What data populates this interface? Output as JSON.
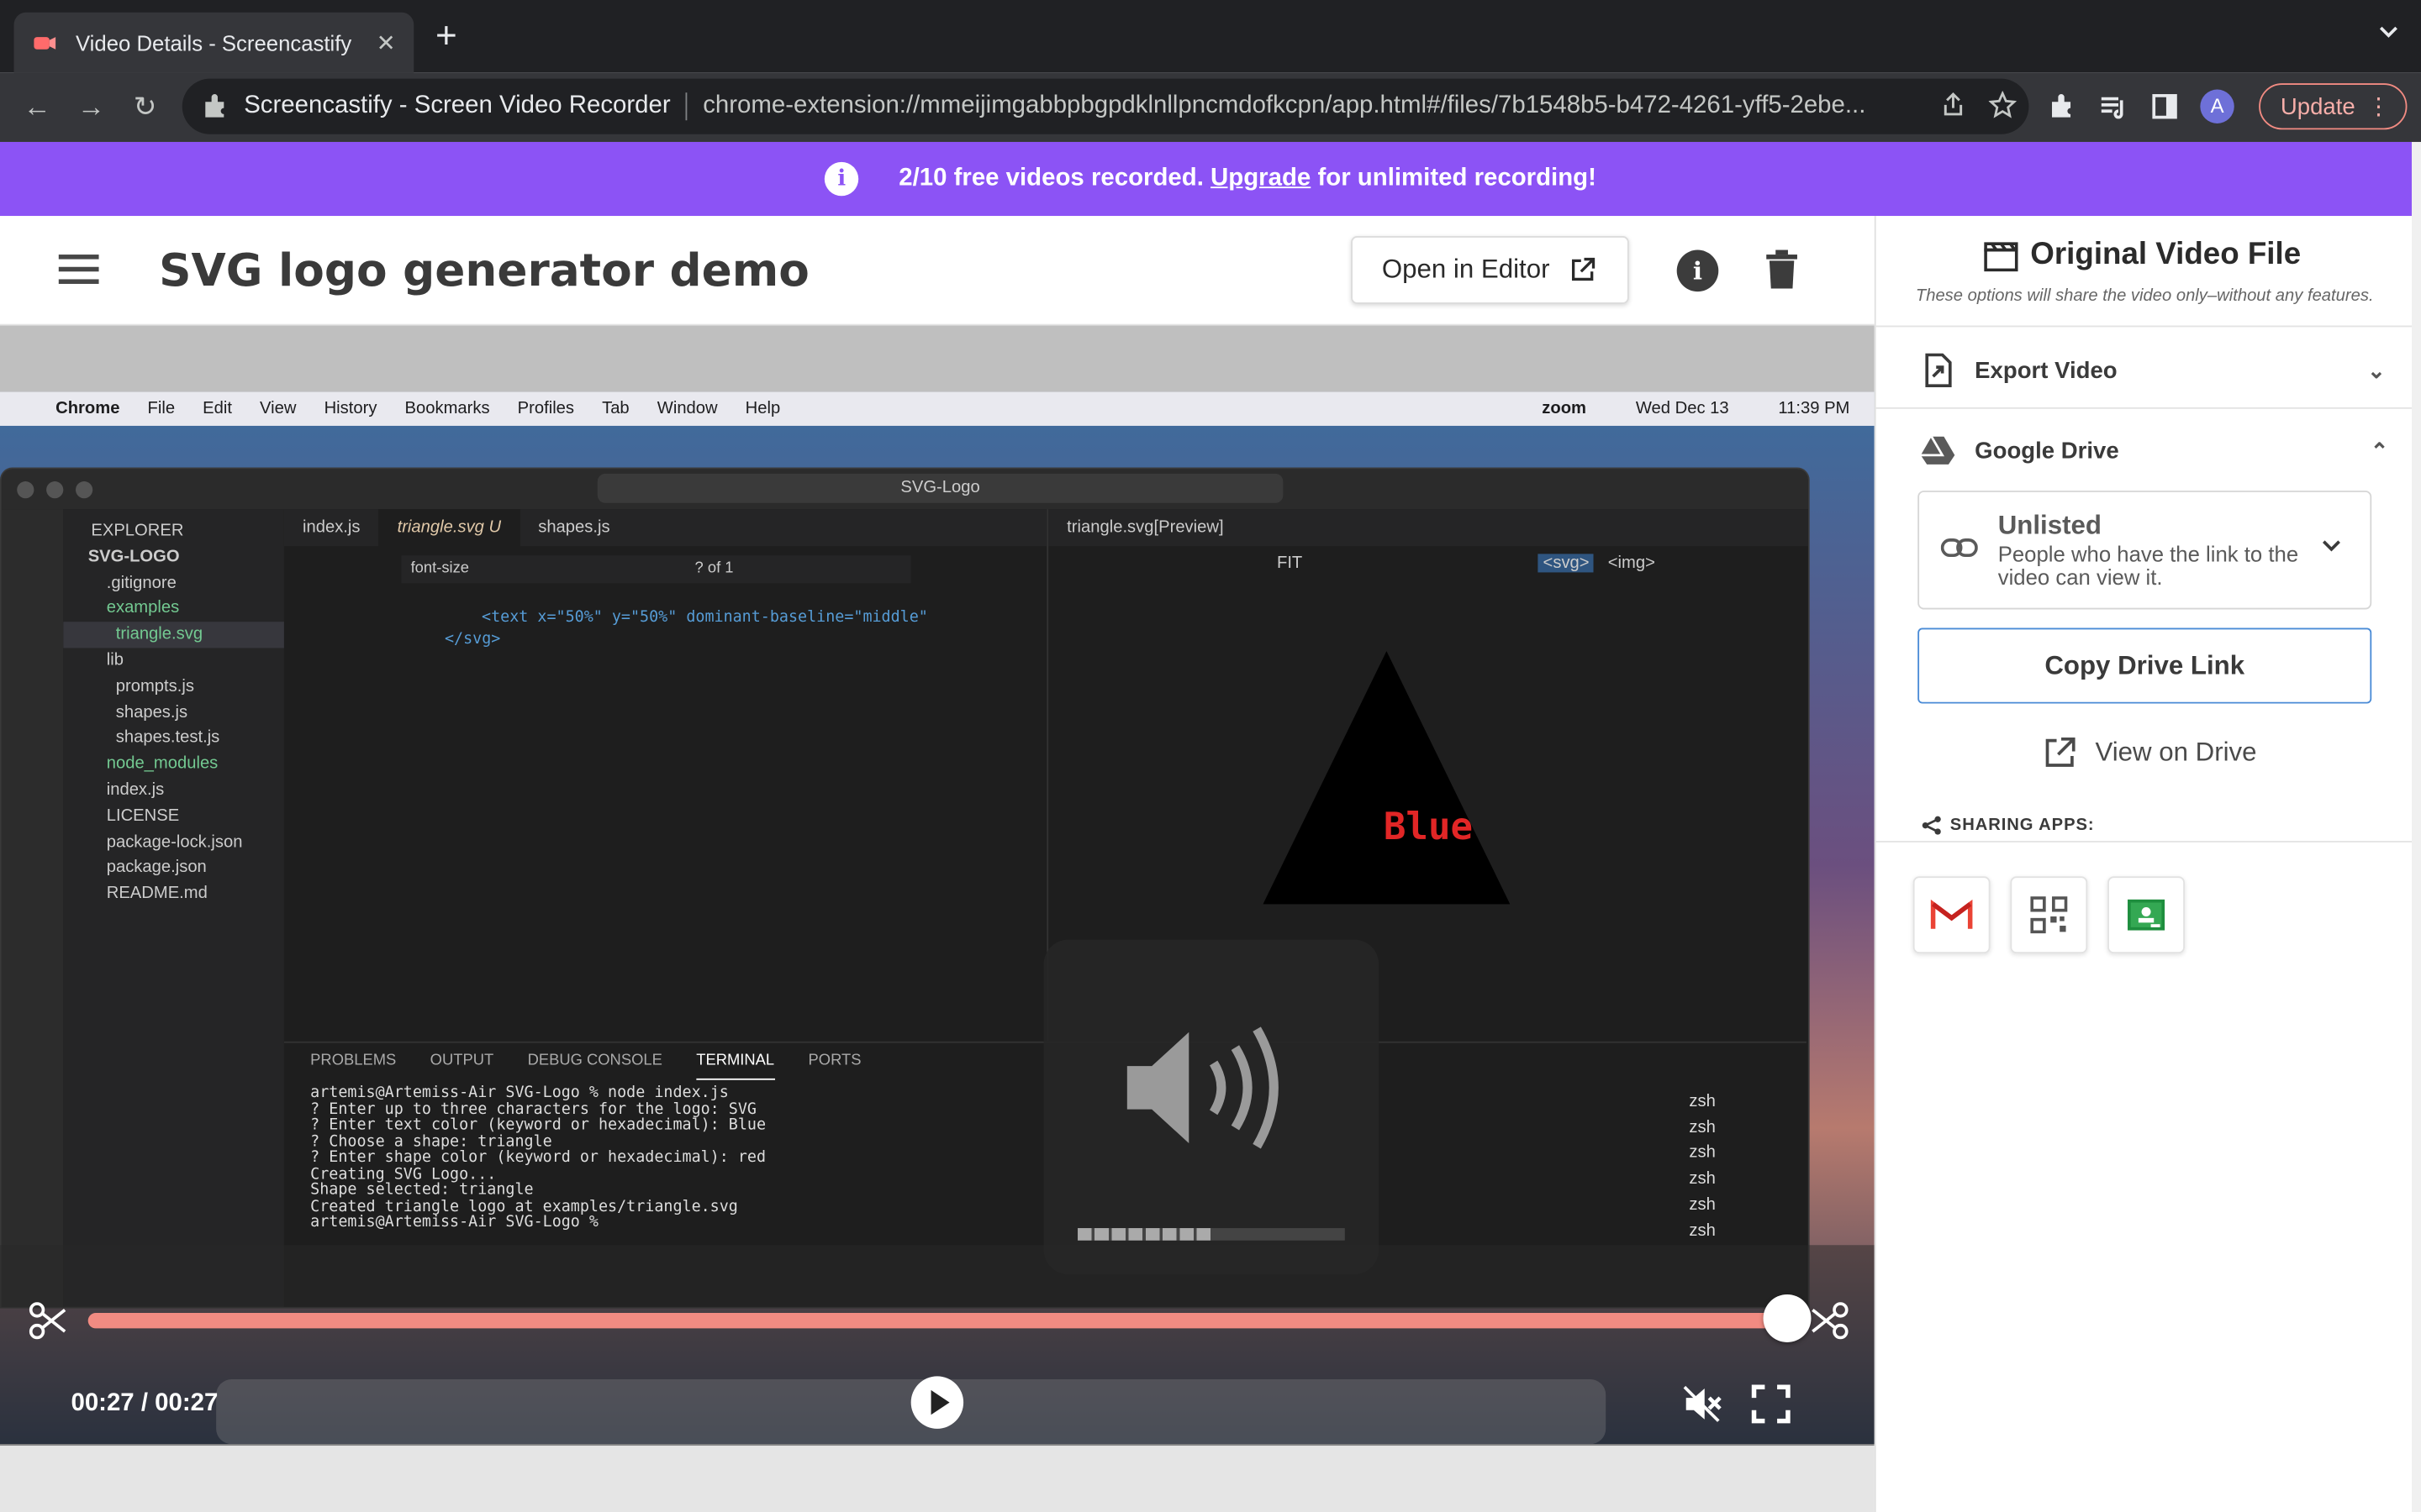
{
  "browser": {
    "tab_title": "Video Details - Screencastify",
    "site_name": "Screencastify - Screen Video Recorder",
    "url": "chrome-extension://mmeijimgabbpbgpdklnllpncmdofkcpn/app.html#/files/7b1548b5-b472-4261-yff5-2ebe...",
    "avatar_letter": "A",
    "update_label": "Update"
  },
  "banner": {
    "text_before": "2/10 free videos recorded.",
    "link": "Upgrade",
    "text_after": "for unlimited recording!"
  },
  "header": {
    "title": "SVG logo generator demo",
    "open_editor_label": "Open in Editor"
  },
  "video": {
    "mac_menu": [
      "Chrome",
      "File",
      "Edit",
      "View",
      "History",
      "Bookmarks",
      "Profiles",
      "Tab",
      "Window",
      "Help"
    ],
    "mac_status": [
      "zoom",
      "Wed Dec 13",
      "11:39 PM"
    ],
    "vscode_search": "SVG-Logo",
    "explorer_title": "EXPLORER",
    "explorer_items": [
      "SVG-LOGO",
      ".gitignore",
      "examples",
      "triangle.svg",
      "lib",
      "prompts.js",
      "shapes.js",
      "shapes.test.js",
      "node_modules",
      "index.js",
      "LICENSE",
      "package-lock.json",
      "package.json",
      "README.md"
    ],
    "editor_tabs": [
      "index.js",
      "triangle.svg U",
      "shapes.js"
    ],
    "find_text": "font-size",
    "find_count": "? of 1",
    "code_lines": [
      "<text x=\"50%\" y=\"50%\" dominant-baseline=\"middle\"",
      "</svg>"
    ],
    "preview_tab": "triangle.svg[Preview]",
    "preview_tools": [
      "FIT",
      "<svg>",
      "<img>"
    ],
    "preview_text": "Blue",
    "terminal_tabs": [
      "PROBLEMS",
      "OUTPUT",
      "DEBUG CONSOLE",
      "TERMINAL",
      "PORTS"
    ],
    "terminal_lines": [
      "artemis@Artemiss-Air SVG-Logo % node index.js",
      "? Enter up to three characters for the logo: SVG",
      "? Enter text color (keyword or hexadecimal): Blue",
      "? Choose a shape: triangle",
      "? Enter shape color (keyword or hexadecimal): red",
      "Creating SVG Logo...",
      "Shape selected: triangle",
      "Created triangle logo at examples/triangle.svg",
      "artemis@Artemiss-Air SVG-Logo % "
    ],
    "shell_items": [
      "zsh",
      "zsh",
      "zsh",
      "zsh",
      "zsh",
      "zsh"
    ],
    "volume_level": 0.5
  },
  "player": {
    "time": "00:27 / 00:27",
    "progress": 1.0
  },
  "side": {
    "title": "Original Video File",
    "subtitle": "These options will share the video only–without any features.",
    "export_label": "Export Video",
    "drive_label": "Google Drive",
    "visibility_label": "Unlisted",
    "visibility_desc": "People who have the link to the video can view it.",
    "copy_link_label": "Copy Drive Link",
    "view_drive_label": "View on Drive",
    "sharing_label": "SHARING APPS:"
  },
  "colors": {
    "banner": "#8c53f5",
    "scrub": "#f28b82",
    "copy_border": "#4a8bd6"
  }
}
